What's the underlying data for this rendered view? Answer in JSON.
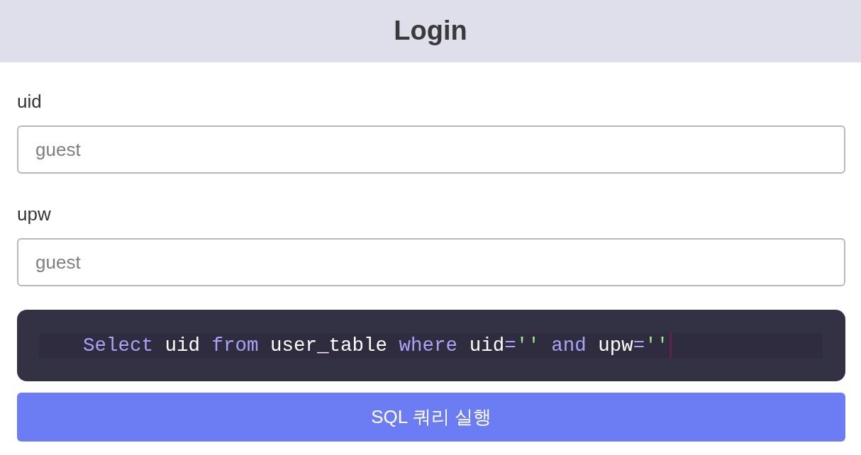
{
  "header": {
    "title": "Login"
  },
  "fields": [
    {
      "label": "uid",
      "placeholder": "guest"
    },
    {
      "label": "upw",
      "placeholder": "guest"
    }
  ],
  "query_editor": {
    "tokens": [
      {
        "text": "Select",
        "kind": "keyword"
      },
      {
        "text": " uid ",
        "kind": "plain"
      },
      {
        "text": "from",
        "kind": "keyword"
      },
      {
        "text": " user_table ",
        "kind": "plain"
      },
      {
        "text": "where",
        "kind": "keyword"
      },
      {
        "text": " uid",
        "kind": "plain"
      },
      {
        "text": "=",
        "kind": "operator"
      },
      {
        "text": "''",
        "kind": "string"
      },
      {
        "text": " and ",
        "kind": "keyword"
      },
      {
        "text": "upw",
        "kind": "plain"
      },
      {
        "text": "=",
        "kind": "operator"
      },
      {
        "text": "''",
        "kind": "string"
      }
    ],
    "cursor_visible": true
  },
  "submit_button": {
    "label": "SQL 쿼리 실행"
  }
}
